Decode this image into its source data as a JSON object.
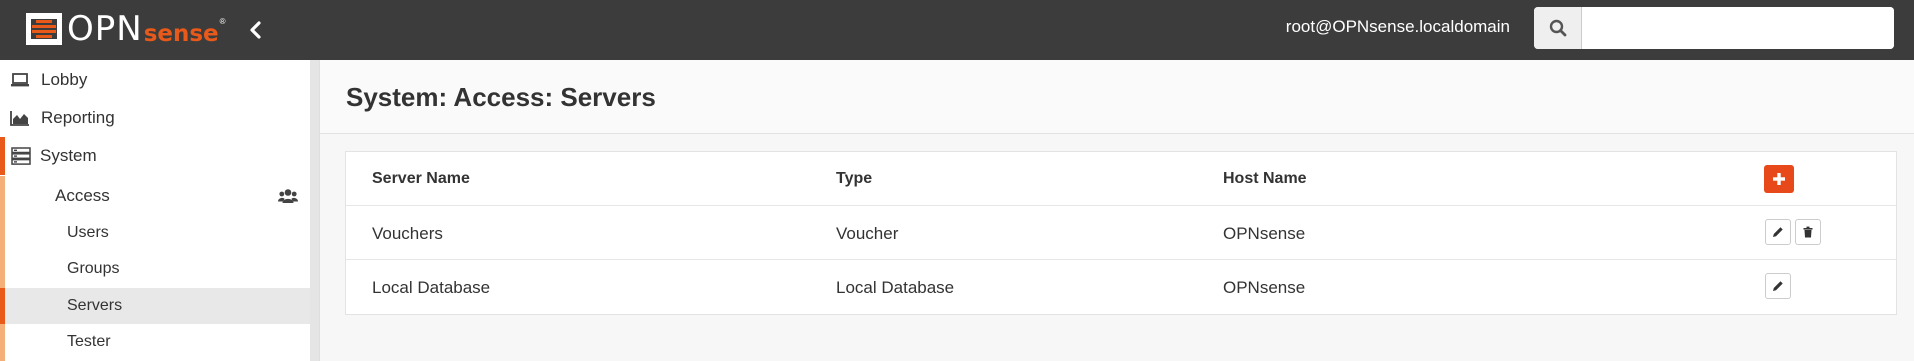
{
  "brand": {
    "logo_opn": "OPN",
    "logo_sense": "sense",
    "logo_reg": "®",
    "accent_color": "#e8591a"
  },
  "header": {
    "user": "root@OPNsense.localdomain",
    "search": {
      "placeholder": "",
      "value": "",
      "icon": "search-icon"
    },
    "collapse_icon": "chevron-left-icon"
  },
  "sidebar": {
    "items": [
      {
        "label": "Lobby",
        "icon": "laptop-icon"
      },
      {
        "label": "Reporting",
        "icon": "area-chart-icon"
      },
      {
        "label": "System",
        "icon": "server-icon",
        "expanded": true
      }
    ],
    "system": {
      "access": {
        "label": "Access",
        "icon": "users-icon",
        "children": [
          {
            "label": "Users"
          },
          {
            "label": "Groups"
          },
          {
            "label": "Servers",
            "active": true
          },
          {
            "label": "Tester"
          }
        ]
      }
    }
  },
  "page": {
    "title": "System: Access: Servers"
  },
  "table": {
    "columns": [
      "Server Name",
      "Type",
      "Host Name"
    ],
    "add_icon": "plus-icon",
    "rows": [
      {
        "name": "Vouchers",
        "type": "Voucher",
        "host": "OPNsense",
        "actions": [
          "edit",
          "delete"
        ]
      },
      {
        "name": "Local Database",
        "type": "Local Database",
        "host": "OPNsense",
        "actions": [
          "edit"
        ]
      }
    ]
  }
}
